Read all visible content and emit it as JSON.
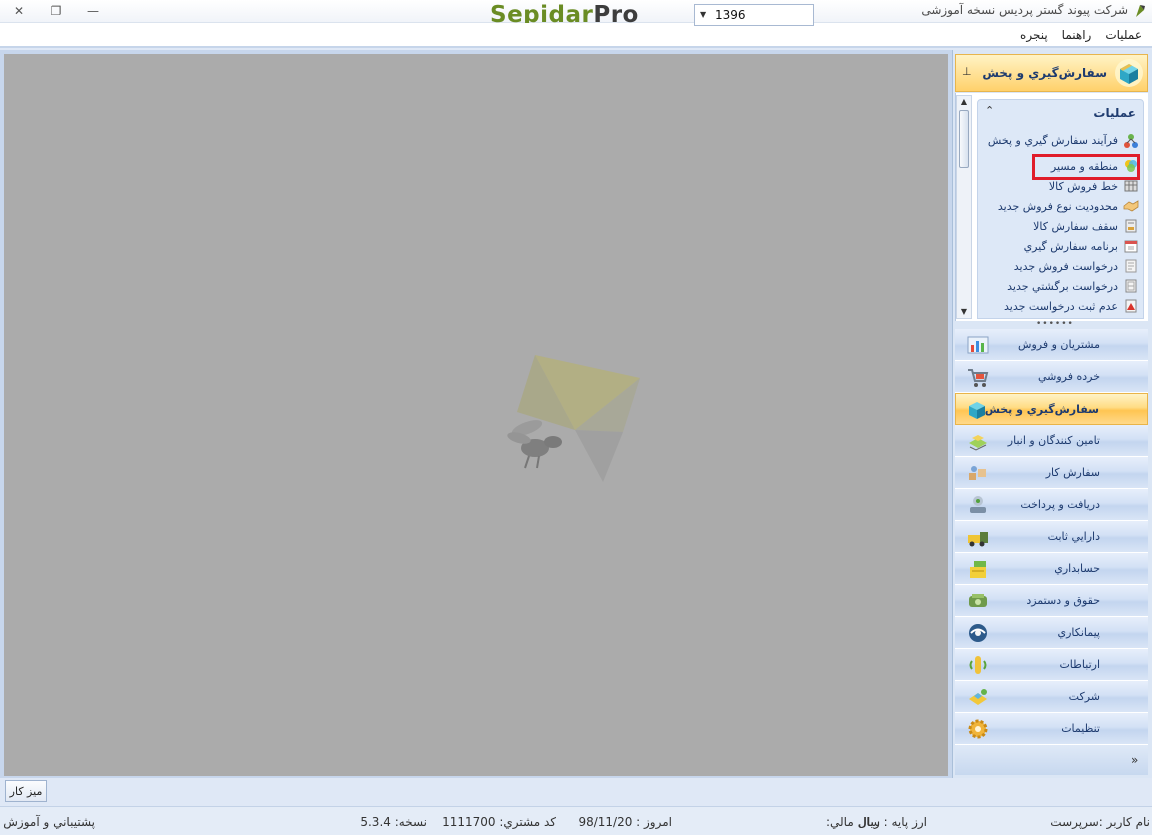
{
  "window": {
    "title": "شرکت پیوند گستر پردیس نسخه آموزشی",
    "brand_part1": "Sepidar",
    "brand_part2": "Pro",
    "close_glyph": "✕",
    "restore_glyph": "❐",
    "minimize_glyph": "—"
  },
  "menu": {
    "items": [
      "عملیات",
      "راهنما",
      "پنجره"
    ]
  },
  "pane": {
    "header_title": "سفارش‌گيري و پخش",
    "pin_glyph": "⊥",
    "group_title": "عمليات",
    "group_collapse_glyph": "⌃",
    "tasks": [
      {
        "label": "فرآيند سفارش گيري و پخش",
        "icon": "process-flow-icon"
      },
      {
        "label": "منطقه و مسير",
        "icon": "region-route-icon"
      },
      {
        "label": "خط فروش كالا",
        "icon": "sales-line-icon"
      },
      {
        "label": "محدوديت نوع فروش جديد",
        "icon": "handshake-icon"
      },
      {
        "label": "سقف سفارش كالا",
        "icon": "order-ceiling-icon"
      },
      {
        "label": "برنامه سفارش گيري",
        "icon": "calendar-icon"
      },
      {
        "label": "درخواست فروش جديد",
        "icon": "sales-request-icon"
      },
      {
        "label": "درخواست برگشتي جديد",
        "icon": "return-request-icon"
      },
      {
        "label": "عدم ثبت درخواست جديد",
        "icon": "no-request-icon"
      }
    ],
    "highlighted_task": "منطقه و مسير",
    "modules": [
      {
        "label": "مشتريان و فروش",
        "icon": "customers-sales-icon",
        "active": false
      },
      {
        "label": "خرده فروشي",
        "icon": "shopping-cart-icon",
        "active": false
      },
      {
        "label": "سفارش‌گيري و پخش",
        "icon": "order-distribution-icon",
        "active": true
      },
      {
        "label": "تامين كنندگان و انبار",
        "icon": "suppliers-warehouse-icon",
        "active": false
      },
      {
        "label": "سفارش كار",
        "icon": "work-order-icon",
        "active": false
      },
      {
        "label": "دريافت و پرداخت",
        "icon": "receive-pay-icon",
        "active": false
      },
      {
        "label": "دارايي ثابت",
        "icon": "fixed-assets-icon",
        "active": false
      },
      {
        "label": "حسابداري",
        "icon": "accounting-icon",
        "active": false
      },
      {
        "label": "حقوق و دستمزد",
        "icon": "payroll-icon",
        "active": false
      },
      {
        "label": "پيمانكاري",
        "icon": "contracting-icon",
        "active": false
      },
      {
        "label": "ارتباطات",
        "icon": "communications-icon",
        "active": false
      },
      {
        "label": "شركت",
        "icon": "company-icon",
        "active": false
      },
      {
        "label": "تنظيمات",
        "icon": "settings-gear-icon",
        "active": false
      }
    ],
    "footer_glyph": "»"
  },
  "taskbar": {
    "desktop_label": "ميز كار"
  },
  "status": {
    "username": "نام كاربر :سرپرست",
    "base_currency": "ارز پايه :   ريال",
    "fiscal_year_label": "سال مالي:",
    "fiscal_year_value": "1396",
    "today": "امروز :       98/11/20",
    "customer_code": "كد مشتري:      1111700",
    "version": "نسخه:      5.3.4",
    "support": "پشتيباني و آموزش",
    "dropdown_glyph": "▼"
  },
  "colors": {
    "accent_active": "#ffc552",
    "highlight_border": "#e01c2a",
    "brand_green": "#6a8c24",
    "workspace_gray": "#ababab"
  }
}
